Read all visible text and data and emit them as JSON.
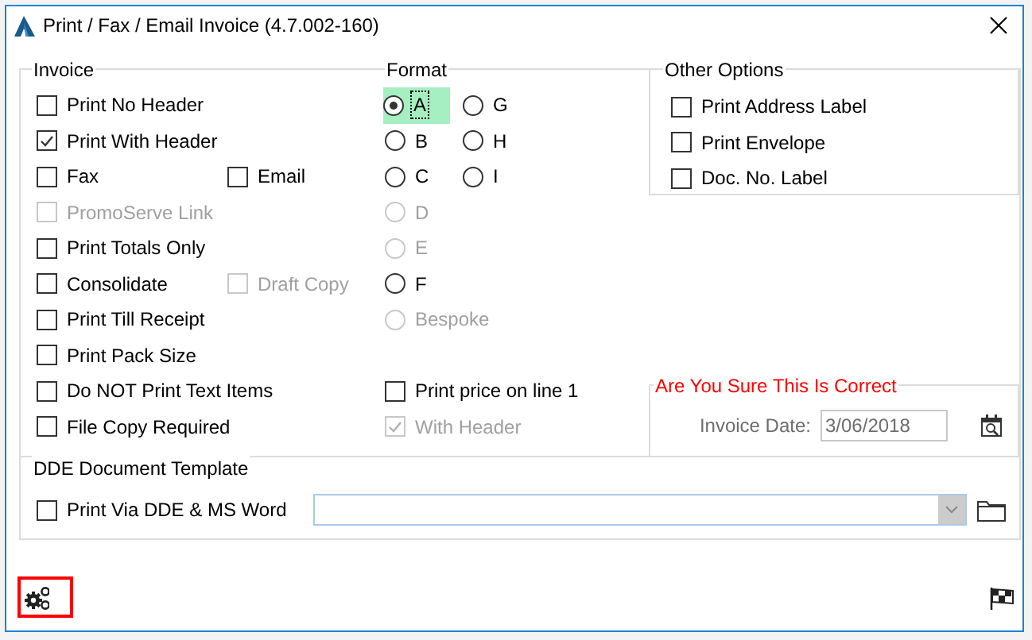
{
  "window": {
    "title": "Print / Fax / Email Invoice (4.7.002-160)"
  },
  "invoice": {
    "title": "Invoice",
    "rows": [
      [
        {
          "label": "Print No Header",
          "checked": false,
          "disabled": false
        }
      ],
      [
        {
          "label": "Print With Header",
          "checked": true,
          "disabled": false
        }
      ],
      [
        {
          "label": "Fax",
          "checked": false,
          "disabled": false
        },
        {
          "label": "Email",
          "checked": false,
          "disabled": false
        }
      ],
      [
        {
          "label": "PromoServe Link",
          "checked": false,
          "disabled": true
        }
      ],
      [
        {
          "label": "Print Totals Only",
          "checked": false,
          "disabled": false
        }
      ],
      [
        {
          "label": "Consolidate",
          "checked": false,
          "disabled": false
        },
        {
          "label": "Draft Copy",
          "checked": false,
          "disabled": true
        }
      ],
      [
        {
          "label": "Print Till Receipt",
          "checked": false,
          "disabled": false
        }
      ],
      [
        {
          "label": "Print Pack Size",
          "checked": false,
          "disabled": false
        }
      ],
      [
        {
          "label": "Do NOT Print Text Items",
          "checked": false,
          "disabled": false
        }
      ],
      [
        {
          "label": "File Copy Required",
          "checked": false,
          "disabled": false
        }
      ]
    ]
  },
  "format": {
    "title": "Format",
    "rows": [
      [
        {
          "label": "A",
          "selected": true,
          "disabled": false,
          "focused": true
        },
        {
          "label": "G",
          "selected": false,
          "disabled": false,
          "focused": false
        }
      ],
      [
        {
          "label": "B",
          "selected": false,
          "disabled": false,
          "focused": false
        },
        {
          "label": "H",
          "selected": false,
          "disabled": false,
          "focused": false
        }
      ],
      [
        {
          "label": "C",
          "selected": false,
          "disabled": false,
          "focused": false
        },
        {
          "label": "I",
          "selected": false,
          "disabled": false,
          "focused": false
        }
      ],
      [
        {
          "label": "D",
          "selected": false,
          "disabled": true,
          "focused": false
        }
      ],
      [
        {
          "label": "E",
          "selected": false,
          "disabled": true,
          "focused": false
        }
      ],
      [
        {
          "label": "F",
          "selected": false,
          "disabled": false,
          "focused": false
        }
      ],
      [
        {
          "label": "Bespoke",
          "selected": false,
          "disabled": true,
          "focused": false
        }
      ]
    ],
    "checkboxes": [
      {
        "label": "Print price on line 1",
        "checked": false,
        "disabled": false
      },
      {
        "label": "With Header",
        "checked": true,
        "disabled": true
      }
    ]
  },
  "other_options": {
    "title": "Other Options",
    "options": [
      {
        "label": "Print Address Label",
        "checked": false,
        "disabled": false
      },
      {
        "label": "Print Envelope",
        "checked": false,
        "disabled": false
      },
      {
        "label": "Doc. No. Label",
        "checked": false,
        "disabled": false
      }
    ]
  },
  "confirm": {
    "title": "Are You Sure This Is Correct",
    "date_label": "Invoice Date:",
    "date_value": "3/06/2018"
  },
  "dde": {
    "title": "DDE Document Template",
    "checkbox": {
      "label": "Print Via DDE & MS Word",
      "checked": false,
      "disabled": false
    },
    "template": {
      "disabled": true
    }
  }
}
